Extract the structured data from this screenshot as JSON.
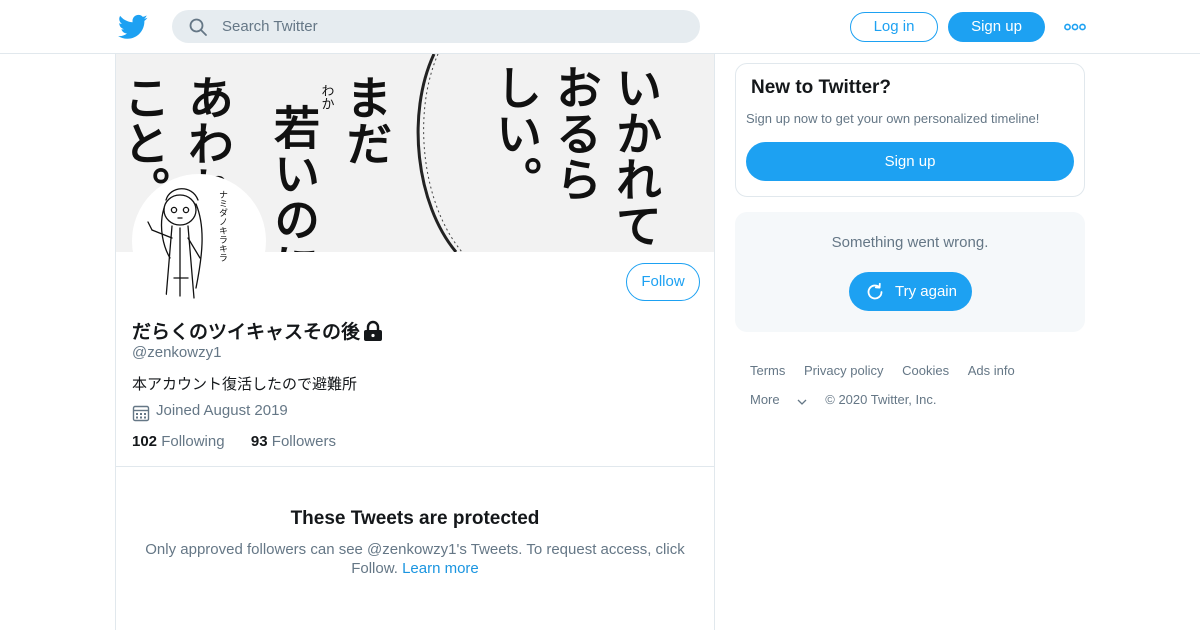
{
  "header": {
    "logo_icon": "twitter-bird-icon",
    "search_placeholder": "Search Twitter",
    "login_label": "Log in",
    "signup_label": "Sign up",
    "more_icon": "more-dots-icon"
  },
  "profile": {
    "display_name": "だらくのツイキャスその後",
    "handle": "@zenkowzy1",
    "bio": "本アカウント復活したので避難所",
    "joined": "Joined August 2019",
    "following_count": "102",
    "following_label": "Following",
    "followers_count": "93",
    "followers_label": "Followers",
    "follow_label": "Follow",
    "locked": true
  },
  "banner": {
    "columns": [
      "こと。",
      "あわれ",
      "若いのに",
      "まだ",
      "しい。",
      "おるら",
      "いかれて"
    ],
    "ruby": "わか"
  },
  "avatar_sketch_text": "ナミダノキラキラ",
  "protected": {
    "title": "These Tweets are protected",
    "text": "Only approved followers can see @zenkowzy1's Tweets. To request access, click Follow.",
    "learn_more": "Learn more"
  },
  "sidebar": {
    "new_title": "New to Twitter?",
    "new_sub": "Sign up now to get your own personalized timeline!",
    "signup_label": "Sign up",
    "error_text": "Something went wrong.",
    "retry_label": "Try again"
  },
  "footer": {
    "links": [
      "Terms",
      "Privacy policy",
      "Cookies",
      "Ads info"
    ],
    "more_label": "More",
    "copyright": "© 2020 Twitter, Inc."
  },
  "colors": {
    "accent": "#1da1f2",
    "link": "#1b95e0",
    "secondary_text": "#657786",
    "border": "#e1e8ed"
  }
}
